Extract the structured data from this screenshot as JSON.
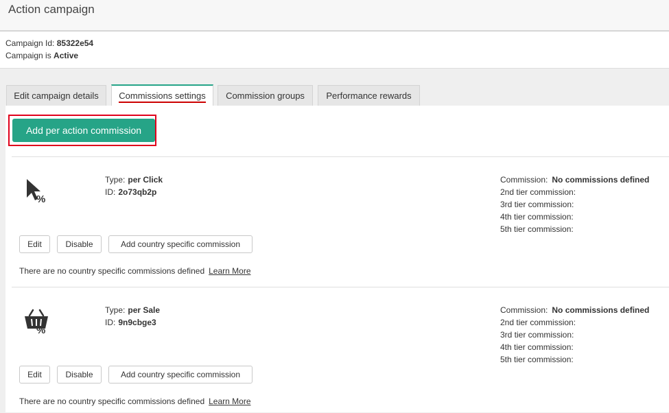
{
  "header": {
    "title": "Action campaign"
  },
  "campaign": {
    "id_label": "Campaign Id:",
    "id_value": "85322e54",
    "status_label": "Campaign is",
    "status_value": "Active"
  },
  "tabs": [
    {
      "label": "Edit campaign details",
      "active": false
    },
    {
      "label": "Commissions settings",
      "active": true
    },
    {
      "label": "Commission groups",
      "active": false
    },
    {
      "label": "Performance rewards",
      "active": false
    }
  ],
  "add_button": {
    "label": "Add per action commission"
  },
  "commissions": [
    {
      "icon": "cursor-percent-icon",
      "type_label": "Type:",
      "type_value": "per Click",
      "id_label": "ID:",
      "id_value": "2o73qb2p",
      "commission_label": "Commission:",
      "commission_value": "No commissions defined",
      "tiers": [
        "2nd tier commission:",
        "3rd tier commission:",
        "4th tier commission:",
        "5th tier commission:"
      ],
      "buttons": {
        "edit": "Edit",
        "disable": "Disable",
        "add_country": "Add country specific commission"
      },
      "note": "There are no country specific commissions defined",
      "learn_more": "Learn More"
    },
    {
      "icon": "basket-percent-icon",
      "type_label": "Type:",
      "type_value": "per Sale",
      "id_label": "ID:",
      "id_value": "9n9cbge3",
      "commission_label": "Commission:",
      "commission_value": "No commissions defined",
      "tiers": [
        "2nd tier commission:",
        "3rd tier commission:",
        "4th tier commission:",
        "5th tier commission:"
      ],
      "buttons": {
        "edit": "Edit",
        "disable": "Disable",
        "add_country": "Add country specific commission"
      },
      "note": "There are no country specific commissions defined",
      "learn_more": "Learn More"
    }
  ],
  "colors": {
    "accent": "#26a487",
    "highlight": "#e0001b"
  }
}
